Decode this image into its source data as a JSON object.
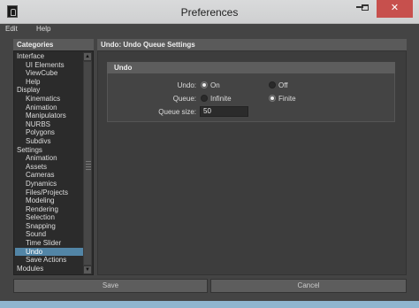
{
  "window": {
    "title": "Preferences",
    "minimize_label": "",
    "close_label": "✕"
  },
  "menu": {
    "items": [
      "Edit",
      "Help"
    ]
  },
  "categories": {
    "header": "Categories",
    "items": [
      {
        "label": "Interface",
        "level": 0
      },
      {
        "label": "UI Elements",
        "level": 1
      },
      {
        "label": "ViewCube",
        "level": 1
      },
      {
        "label": "Help",
        "level": 1
      },
      {
        "label": "Display",
        "level": 0
      },
      {
        "label": "Kinematics",
        "level": 1
      },
      {
        "label": "Animation",
        "level": 1
      },
      {
        "label": "Manipulators",
        "level": 1
      },
      {
        "label": "NURBS",
        "level": 1
      },
      {
        "label": "Polygons",
        "level": 1
      },
      {
        "label": "Subdivs",
        "level": 1
      },
      {
        "label": "Settings",
        "level": 0
      },
      {
        "label": "Animation",
        "level": 1
      },
      {
        "label": "Assets",
        "level": 1
      },
      {
        "label": "Cameras",
        "level": 1
      },
      {
        "label": "Dynamics",
        "level": 1
      },
      {
        "label": "Files/Projects",
        "level": 1
      },
      {
        "label": "Modeling",
        "level": 1
      },
      {
        "label": "Rendering",
        "level": 1
      },
      {
        "label": "Selection",
        "level": 1
      },
      {
        "label": "Snapping",
        "level": 1
      },
      {
        "label": "Sound",
        "level": 1
      },
      {
        "label": "Time Slider",
        "level": 1
      },
      {
        "label": "Undo",
        "level": 1,
        "selected": true
      },
      {
        "label": "Save Actions",
        "level": 1
      },
      {
        "label": "Modules",
        "level": 0
      }
    ]
  },
  "settings": {
    "header": "Undo: Undo Queue Settings",
    "frame_title": "Undo",
    "undo": {
      "label": "Undo:",
      "on_label": "On",
      "off_label": "Off",
      "selected": "On"
    },
    "queue": {
      "label": "Queue:",
      "infinite_label": "Infinite",
      "finite_label": "Finite",
      "selected": "Finite"
    },
    "queue_size": {
      "label": "Queue size:",
      "value": "50"
    }
  },
  "buttons": {
    "save": "Save",
    "cancel": "Cancel"
  },
  "colors": {
    "selection": "#5285a6",
    "close_button": "#c7504d"
  }
}
